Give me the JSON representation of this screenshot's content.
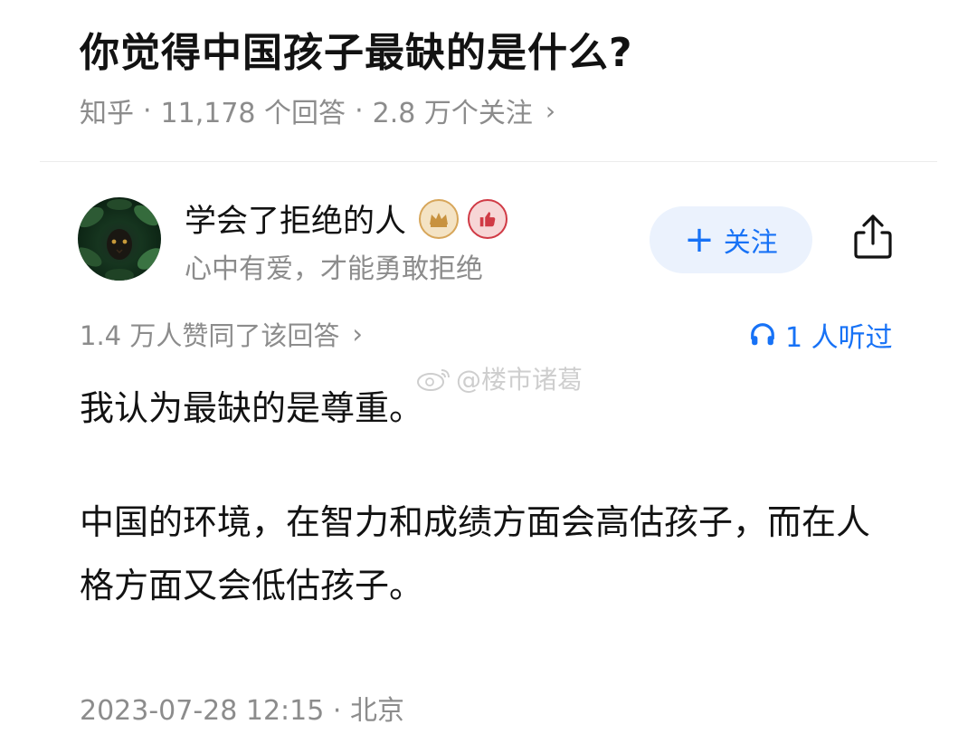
{
  "question": {
    "title": "你觉得中国孩子最缺的是什么?",
    "source": "知乎",
    "answers": "11,178 个回答",
    "followers": "2.8 万个关注",
    "separator": "·",
    "chevron": "›"
  },
  "author": {
    "name": "学会了拒绝的人",
    "bio": "心中有爱，才能勇敢拒绝",
    "badges": [
      "crown-badge-icon",
      "thumbs-up-badge-icon"
    ],
    "avatar": "dark-green-leaves-avatar"
  },
  "actions": {
    "follow_label": "关注",
    "follow_plus": "+",
    "share_icon": "share-icon"
  },
  "stats": {
    "agree_text": "1.4 万人赞同了该回答",
    "listened_text": "1 人听过"
  },
  "watermark": "@楼市诸葛",
  "content": {
    "paragraphs": [
      "我认为最缺的是尊重。",
      "中国的环境，在智力和成绩方面会高估孩子，而在人格方面又会低估孩子。"
    ]
  },
  "footer": {
    "timestamp": "2023-07-28 12:15 · 北京"
  },
  "colors": {
    "accent": "#1772f6",
    "follow_bg": "#ebf2fd",
    "meta_gray": "#8c8c8c",
    "text": "#121212"
  }
}
